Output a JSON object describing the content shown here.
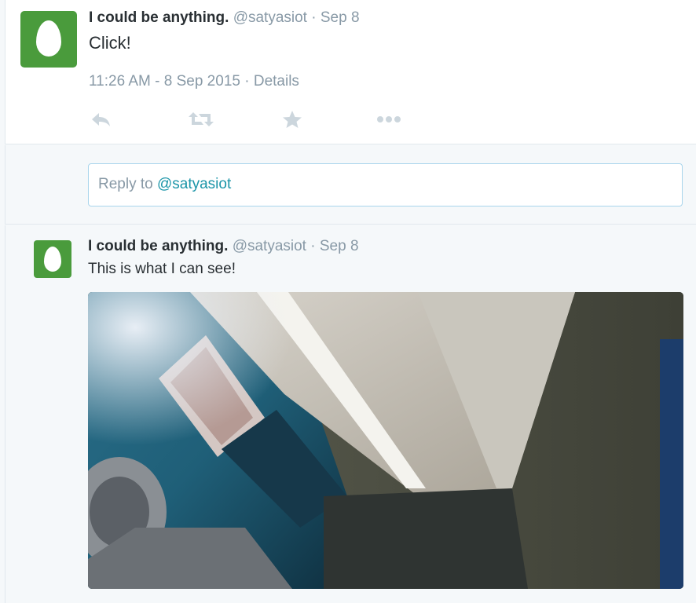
{
  "main_tweet": {
    "fullname": "I could be anything.",
    "username": "@satyasiot",
    "separator": "·",
    "date": "Sep 8",
    "text": "Click!",
    "timestamp": "11:26 AM - 8 Sep 2015",
    "details_separator": "·",
    "details_label": "Details",
    "actions": [
      {
        "name": "reply",
        "icon": "reply-icon"
      },
      {
        "name": "retweet",
        "icon": "retweet-icon"
      },
      {
        "name": "favorite",
        "icon": "star-icon"
      },
      {
        "name": "more",
        "icon": "more-dots-icon"
      }
    ]
  },
  "reply_box": {
    "prefix": "Reply to",
    "mention": "@satyasiot"
  },
  "reply_tweet": {
    "fullname": "I could be anything.",
    "username": "@satyasiot",
    "separator": "·",
    "date": "Sep 8",
    "text": "This is what I can see!"
  },
  "colors": {
    "avatar_bg": "#4a9b3c",
    "link": "#1b95a8",
    "muted": "#8899a6",
    "action_icon": "#ccd6dd",
    "page_bg": "#f5f8fa"
  }
}
